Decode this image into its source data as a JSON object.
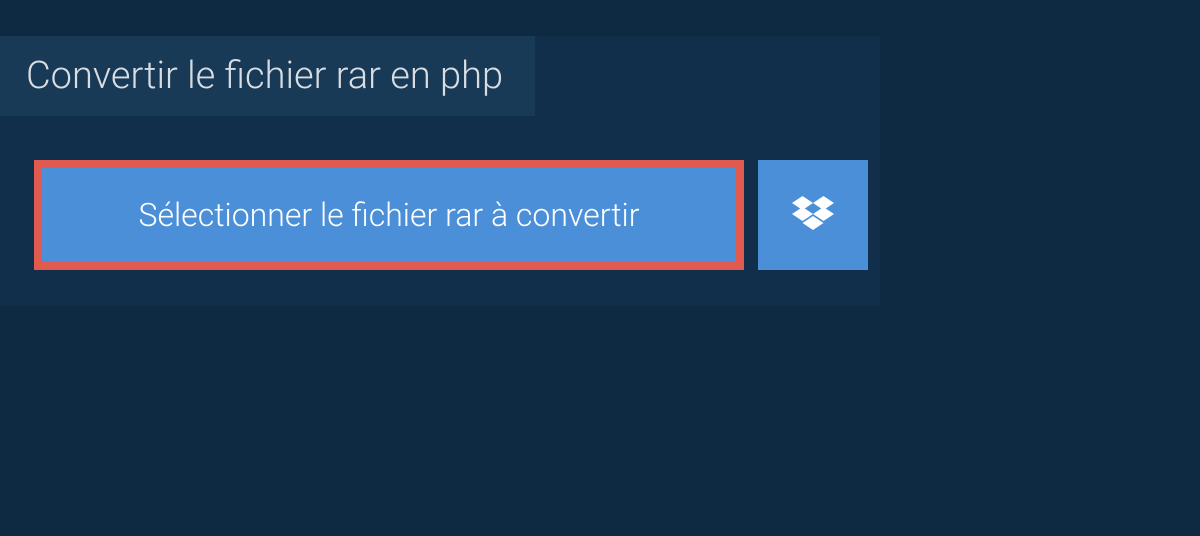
{
  "header": {
    "title": "Convertir le fichier rar en php"
  },
  "actions": {
    "select_file_label": "Sélectionner le fichier rar à convertir"
  }
}
